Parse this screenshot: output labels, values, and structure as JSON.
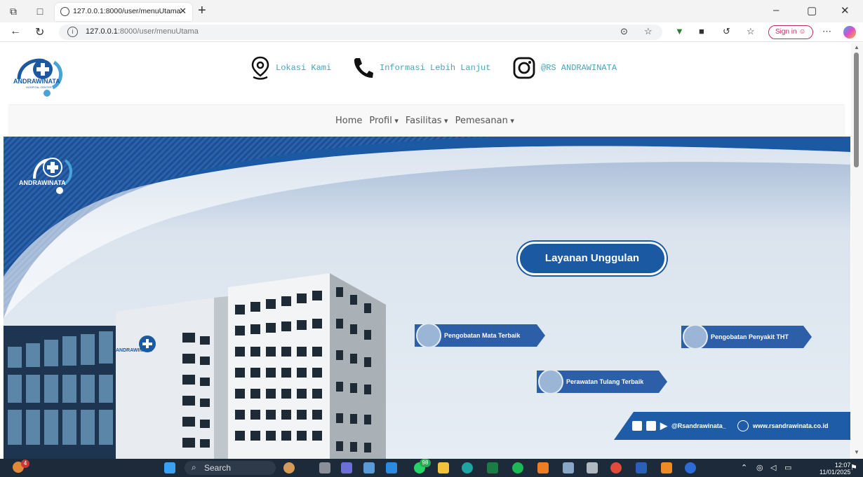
{
  "browser": {
    "tab_title": "127.0.0.1:8000/user/menuUtama",
    "url_host": "127.0.0.1",
    "url_rest": ":8000/user/menuUtama",
    "signin_label": "Sign in"
  },
  "header": {
    "location": "Lokasi Kami",
    "info": "Informasi Lebih Lanjut",
    "instagram": "@RS ANDRAWINATA",
    "logo_text": "ANDRAWINATA",
    "logo_sub": "HOSPITAL CENTER"
  },
  "nav": {
    "home": "Home",
    "profil": "Profil",
    "fasilitas": "Fasilitas",
    "pemesanan": "Pemesanan"
  },
  "hero": {
    "logo_text": "ANDRAWINATA",
    "building_logo_text": "ANDRAWINATA",
    "headline": "Layanan Unggulan",
    "services": {
      "mata": "Pengobatan Mata Terbaik",
      "tht": "Pengobatan Penyakit THT",
      "tulang": "Perawatan Tulang Terbaik"
    },
    "social_handle": "@Rsandrawinata_",
    "website": "www.rsandrawinata.co.id"
  },
  "taskbar": {
    "search_label": "Search",
    "notif_count": "4",
    "whatsapp_badge": "98",
    "time": "12:07",
    "date": "11/01/2025"
  },
  "colors": {
    "brand_blue": "#1b5aa3",
    "info_teal": "#4aa3b8"
  }
}
